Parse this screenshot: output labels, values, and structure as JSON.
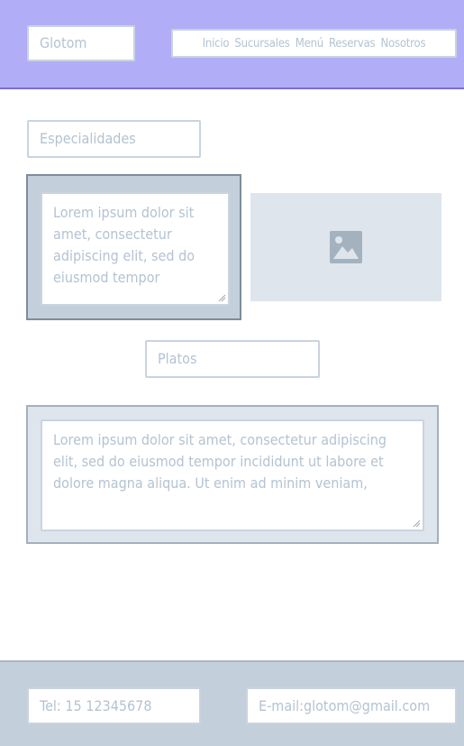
{
  "header": {
    "logo": "Glotom",
    "nav": [
      "Inicio",
      "Sucursales",
      "Menú",
      "Reservas",
      "Nosotros"
    ]
  },
  "especialidades": {
    "label": "Especialidades",
    "text": "Lorem ipsum dolor sit amet, consectetur adipiscing elit, sed do eiusmod tempor",
    "image_icon": "image-icon"
  },
  "platos": {
    "label": "Platos",
    "text": "Lorem ipsum dolor sit amet, consectetur adipiscing elit, sed do eiusmod tempor incididunt ut labore et dolore magna aliqua. Ut enim ad minim veniam,"
  },
  "footer": {
    "tel": "Tel: 15 12345678",
    "email": "E-mail:glotom@gmail.com"
  },
  "colors": {
    "header_bg": "#b1aef7",
    "header_border": "#7c6fd6",
    "text": "#b4c3d1",
    "card_bg": "#c3cfda",
    "footer_bg": "#c3cfda"
  }
}
